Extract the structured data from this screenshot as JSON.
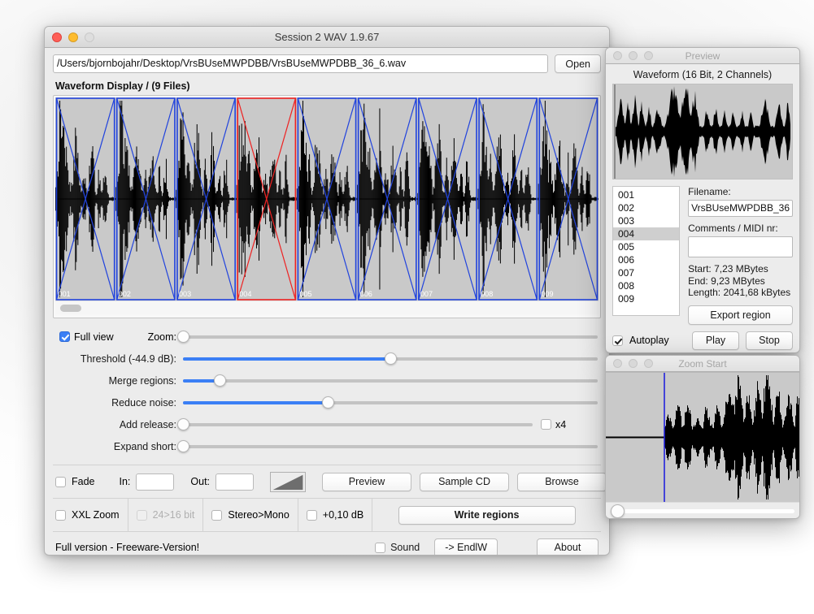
{
  "main_window": {
    "title": "Session 2 WAV 1.9.67",
    "path_value": "/Users/bjornbojahr/Desktop/VrsBUseMWPDBB/VrsBUseMWPDBB_36_6.wav",
    "open_label": "Open",
    "waveform_section_label": "Waveform Display / (9 Files)",
    "regions": [
      {
        "id": "001",
        "selected": false
      },
      {
        "id": "002",
        "selected": false
      },
      {
        "id": "003",
        "selected": false
      },
      {
        "id": "004",
        "selected": true
      },
      {
        "id": "005",
        "selected": false
      },
      {
        "id": "006",
        "selected": false
      },
      {
        "id": "007",
        "selected": false
      },
      {
        "id": "008",
        "selected": false
      },
      {
        "id": "009",
        "selected": false
      }
    ],
    "region_color": "#2244dd",
    "region_color_selected": "#ee2222",
    "full_view_label": "Full view",
    "full_view_checked": true,
    "sliders": [
      {
        "label": "Zoom:",
        "percent": 0,
        "filled": false
      },
      {
        "label": "Threshold (-44.9 dB):",
        "percent": 50,
        "filled": true
      },
      {
        "label": "Merge regions:",
        "percent": 9,
        "filled": true
      },
      {
        "label": "Reduce noise:",
        "percent": 35,
        "filled": true
      },
      {
        "label": "Add release:",
        "percent": 0,
        "filled": false
      },
      {
        "label": "Expand short:",
        "percent": 0,
        "filled": false
      }
    ],
    "x4_label": "x4",
    "x4_checked": false,
    "fade_label": "Fade",
    "fade_checked": false,
    "in_label": "In:",
    "in_value": "",
    "out_label": "Out:",
    "out_value": "",
    "preview_label": "Preview",
    "sample_cd_label": "Sample CD",
    "browse_label": "Browse",
    "xxl_zoom_label": "XXL Zoom",
    "xxl_zoom_checked": false,
    "bit_label": "24>16 bit",
    "bit_checked": false,
    "bit_disabled": true,
    "stereo_mono_label": "Stereo>Mono",
    "stereo_mono_checked": false,
    "gain_label": "+0,10 dB",
    "gain_checked": false,
    "write_regions_label": "Write regions",
    "version_text": "Full version -  Freeware-Version!",
    "sound_label": "Sound",
    "sound_checked": false,
    "endlw_label": "-> EndlW",
    "about_label": "About"
  },
  "preview_window": {
    "title": "Preview",
    "waveform_header": "Waveform (16 Bit, 2 Channels)",
    "list_items": [
      "001",
      "002",
      "003",
      "004",
      "005",
      "006",
      "007",
      "008",
      "009"
    ],
    "selected_item": "004",
    "filename_label": "Filename:",
    "filename_value": "VrsBUseMWPDBB_36",
    "comments_label": "Comments / MIDI nr:",
    "comments_value": "",
    "start_text": "Start: 7,23 MBytes",
    "end_text": "End: 9,23 MBytes",
    "length_text": "Length: 2041,68 kBytes",
    "export_region_label": "Export region",
    "autoplay_label": "Autoplay",
    "autoplay_checked": true,
    "play_label": "Play",
    "stop_label": "Stop"
  },
  "zoom_window": {
    "title": "Zoom Start",
    "cursor_color": "#2222dd",
    "scroll_position": 0
  },
  "colors": {
    "accent": "#3b7ff5",
    "window_bg": "#ececec",
    "waveform_bg": "#c9c9c9",
    "waveform_fg": "#000000"
  }
}
